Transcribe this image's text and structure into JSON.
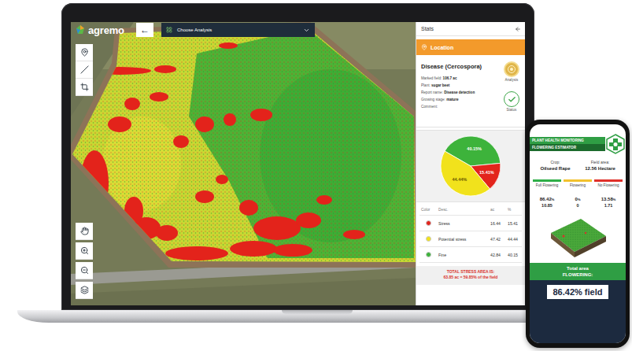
{
  "laptop": {
    "logo": "agremo",
    "back_button": "←",
    "analysis_select": "Choose Analysis",
    "stats": {
      "title": "Stats",
      "location": "Location",
      "report": {
        "title": "Disease (Cercospora)",
        "fields": [
          {
            "label": "Marked field:",
            "value": "106.7 ac"
          },
          {
            "label": "Plant:",
            "value": "sugar beet"
          },
          {
            "label": "Report name:",
            "value": "Disease detection"
          },
          {
            "label": "Growing stage:",
            "value": "mature"
          },
          {
            "label": "Comment:"
          }
        ]
      },
      "badges": [
        {
          "label": "Analysis",
          "kind": "medal"
        },
        {
          "label": "Status",
          "kind": "check"
        }
      ],
      "pie": {
        "slices": [
          {
            "value": 40.15,
            "label": "40.15%",
            "color": "#3db33b"
          },
          {
            "value": 15.41,
            "label": "15.41%",
            "color": "#e3241c"
          },
          {
            "value": 44.44,
            "label": "44.44%",
            "color": "#f1e21c"
          }
        ]
      },
      "table": {
        "columns": [
          "Color",
          "Desc.",
          "ac",
          "%"
        ],
        "rows": [
          {
            "desc": "Stress",
            "ac": "16.44",
            "pct": "15.41",
            "color": "#e3241c"
          },
          {
            "desc": "Potential stress",
            "ac": "47.42",
            "pct": "44.44",
            "color": "#f1e21c"
          },
          {
            "desc": "Fine",
            "ac": "42.84",
            "pct": "40.15",
            "color": "#3db33b"
          }
        ]
      },
      "total": {
        "title": "TOTAL STRESS AREA IS:",
        "value": "63.85 ac = 59.85% of the field"
      }
    }
  },
  "phone": {
    "header": "PLANT HEALTH MONITORING",
    "subheader": "FLOWERING ESTIMATOR",
    "crop_label": "Crop:",
    "crop": "Oilseed Rape",
    "area_label": "Field area:",
    "area": "12.56 Hectare",
    "classes": [
      {
        "label": "Full Flowering",
        "pct": "86.42",
        "unit": "%",
        "area": "10.85",
        "color": "#2fae48"
      },
      {
        "label": "Flowering",
        "pct": "0",
        "unit": "%",
        "area": "0",
        "color": "#f2c12e"
      },
      {
        "label": "No Flowering",
        "pct": "13.58",
        "unit": "%",
        "area": "1.71",
        "color": "#e0302a"
      }
    ],
    "total_label": [
      "Total area",
      "FLOWERING:"
    ],
    "total": "86.42% field"
  }
}
